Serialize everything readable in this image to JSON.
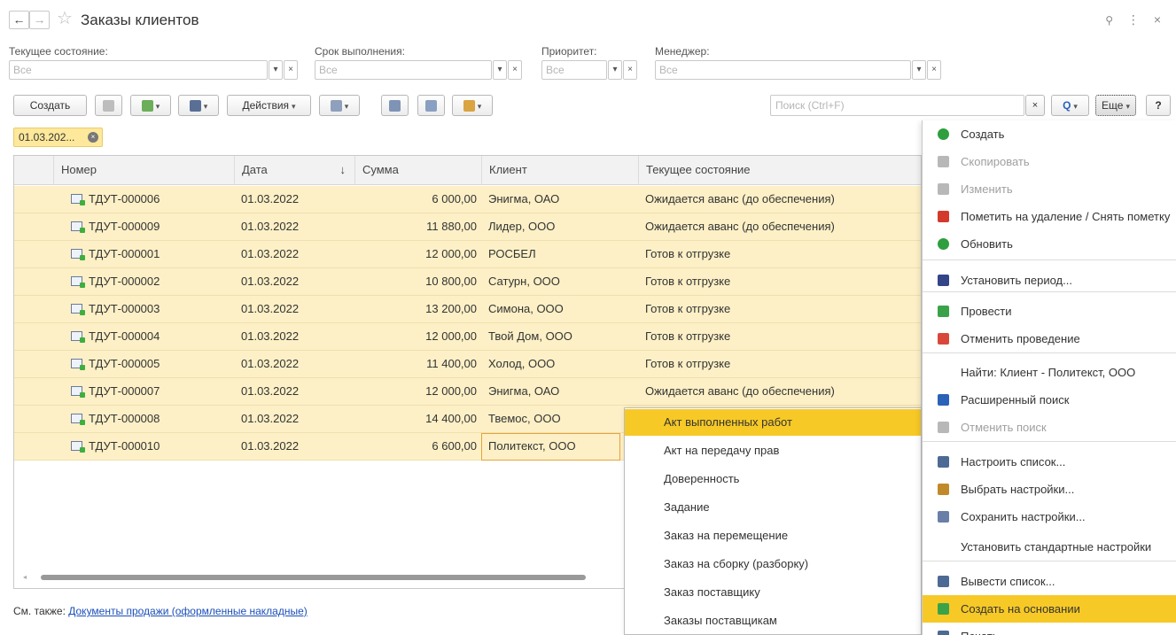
{
  "window": {
    "title": "Заказы клиентов",
    "back_glyph": "←",
    "forward_glyph": "→",
    "star_glyph": "☆",
    "link_glyph": "🔗",
    "more_glyph": "⋮",
    "close_glyph": "×"
  },
  "filters": {
    "state_label": "Текущее состояние:",
    "state_placeholder": "Все",
    "deadline_label": "Срок выполнения:",
    "deadline_placeholder": "Все",
    "priority_label": "Приоритет:",
    "priority_placeholder": "Все",
    "manager_label": "Менеджер:",
    "manager_placeholder": "Все",
    "dropdown_glyph": "▾",
    "clear_glyph": "×"
  },
  "toolbar": {
    "create_label": "Создать",
    "actions_label": "Действия",
    "search_placeholder": "Поиск (Ctrl+F)",
    "search_clear": "×",
    "search_glyph": "Q",
    "more_label": "Еще",
    "help_label": "?"
  },
  "filter_tag": {
    "text": "01.03.202...",
    "remove_glyph": "×"
  },
  "table": {
    "columns": [
      "Номер",
      "Дата",
      "Сумма",
      "Клиент",
      "Текущее состояние"
    ],
    "sort_glyph": "↓",
    "rows": [
      [
        "ТДУТ-000006",
        "01.03.2022",
        "6 000,00",
        "Энигма, ОАО",
        "Ожидается аванс (до обеспечения)"
      ],
      [
        "ТДУТ-000009",
        "01.03.2022",
        "11 880,00",
        "Лидер, ООО",
        "Ожидается аванс (до обеспечения)"
      ],
      [
        "ТДУТ-000001",
        "01.03.2022",
        "12 000,00",
        "РОСБЕЛ",
        "Готов к отгрузке"
      ],
      [
        "ТДУТ-000002",
        "01.03.2022",
        "10 800,00",
        "Сатурн, ООО",
        "Готов к отгрузке"
      ],
      [
        "ТДУТ-000003",
        "01.03.2022",
        "13 200,00",
        "Симона, ООО",
        "Готов к отгрузке"
      ],
      [
        "ТДУТ-000004",
        "01.03.2022",
        "12 000,00",
        "Твой Дом, ООО",
        "Готов к отгрузке"
      ],
      [
        "ТДУТ-000005",
        "01.03.2022",
        "11 400,00",
        "Холод, ООО",
        "Готов к отгрузке"
      ],
      [
        "ТДУТ-000007",
        "01.03.2022",
        "12 000,00",
        "Энигма, ОАО",
        "Ожидается аванс (до обеспечения)"
      ],
      [
        "ТДУТ-000008",
        "01.03.2022",
        "14 400,00",
        "Твемос, ООО",
        ""
      ],
      [
        "ТДУТ-000010",
        "01.03.2022",
        "6 600,00",
        "Политекст, ООО",
        ""
      ]
    ]
  },
  "see_also": {
    "prefix": "См. также:",
    "link": "Документы продажи (оформленные накладные)"
  },
  "more_menu": {
    "items": [
      {
        "label": "Создать",
        "disabled": false,
        "highlight": false,
        "icon": "plus-icon",
        "color": "#2e9e3e"
      },
      {
        "label": "Скопировать",
        "disabled": true,
        "highlight": false,
        "icon": "copy-icon",
        "color": "#b8b8b8"
      },
      {
        "label": "Изменить",
        "disabled": true,
        "highlight": false,
        "icon": "pencil-icon",
        "color": "#b8b8b8"
      },
      {
        "label": "Пометить на удаление / Снять пометку",
        "disabled": false,
        "highlight": false,
        "icon": "delete-mark-icon",
        "color": "#d33a2c"
      },
      {
        "label": "Обновить",
        "disabled": false,
        "highlight": false,
        "icon": "refresh-icon",
        "color": "#2e9e3e"
      },
      {
        "label": "Установить период...",
        "disabled": false,
        "highlight": false,
        "icon": "period-icon",
        "color": "#334488"
      },
      {
        "label": "Провести",
        "disabled": false,
        "highlight": false,
        "icon": "post-icon",
        "color": "#3aa34a"
      },
      {
        "label": "Отменить проведение",
        "disabled": false,
        "highlight": false,
        "icon": "unpost-icon",
        "color": "#d9473b"
      },
      {
        "label": "Найти: Клиент - Политекст, ООО",
        "disabled": false,
        "highlight": false,
        "icon": "",
        "color": ""
      },
      {
        "label": "Расширенный поиск",
        "disabled": false,
        "highlight": false,
        "icon": "advanced-search-icon",
        "color": "#2a62b8"
      },
      {
        "label": "Отменить поиск",
        "disabled": true,
        "highlight": false,
        "icon": "cancel-search-icon",
        "color": "#b8b8b8"
      },
      {
        "label": "Настроить список...",
        "disabled": false,
        "highlight": false,
        "icon": "list-settings-icon",
        "color": "#4d6a94"
      },
      {
        "label": "Выбрать настройки...",
        "disabled": false,
        "highlight": false,
        "icon": "choose-settings-icon",
        "color": "#c08a2a"
      },
      {
        "label": "Сохранить настройки...",
        "disabled": false,
        "highlight": false,
        "icon": "save-settings-icon",
        "color": "#6a7fa8"
      },
      {
        "label": "Установить стандартные настройки",
        "disabled": false,
        "highlight": false,
        "icon": "",
        "color": ""
      },
      {
        "label": "Вывести список...",
        "disabled": false,
        "highlight": false,
        "icon": "output-list-icon",
        "color": "#4d6a94"
      },
      {
        "label": "Создать на основании",
        "disabled": false,
        "highlight": true,
        "icon": "create-based-icon",
        "color": "#3aa34a"
      },
      {
        "label": "Печать",
        "disabled": false,
        "highlight": false,
        "icon": "print-icon",
        "color": "#4d6a94"
      }
    ]
  },
  "submenu": {
    "items": [
      "Акт выполненных работ",
      "Акт на передачу прав",
      "Доверенность",
      "Задание",
      "Заказ на перемещение",
      "Заказ на сборку (разборку)",
      "Заказ поставщику",
      "Заказы поставщикам"
    ]
  },
  "colors": {
    "row_bg": "#fdf0c6",
    "highlight": "#f7c926",
    "link": "#1b4fb8"
  }
}
